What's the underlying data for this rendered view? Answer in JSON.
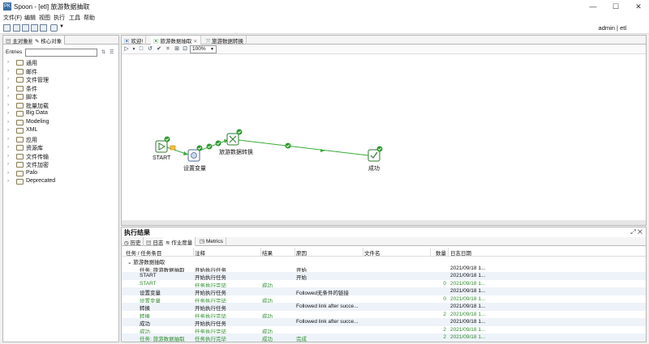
{
  "window": {
    "title": "Spoon - [etl] 旅游数据抽取",
    "app_icon": "PK",
    "minimize": "—",
    "maximize": "☐",
    "close": "✕"
  },
  "menu": [
    "文件(F)",
    "编辑",
    "视图",
    "执行",
    "工具",
    "帮助"
  ],
  "user": "admin  |  etl",
  "left_panel": {
    "tabs": [
      "主对象树",
      "核心对象"
    ],
    "entries_label": "Entries",
    "entries_value": "",
    "tree": [
      "通用",
      "邮件",
      "文件管理",
      "条件",
      "脚本",
      "批量加载",
      "Big Data",
      "Modeling",
      "XML",
      "应用",
      "资源库",
      "文件传输",
      "文件加密",
      "Palo",
      "Deprecated"
    ]
  },
  "editor": {
    "tabs": [
      "欢迎!",
      "旅游数据抽取",
      "旅游数据转换"
    ],
    "zoom": "100%",
    "nodes": {
      "start": "START",
      "set_var": "设置变量",
      "transform": "旅游数据转换",
      "success": "成功"
    }
  },
  "results": {
    "title": "执行结果",
    "tabs": [
      "历史",
      "日志",
      "作业度量",
      "Metrics"
    ],
    "columns": [
      "任务 / 任务条目",
      "注释",
      "结果",
      "原因",
      "文件名",
      "数量",
      "日志日期"
    ],
    "group": "旅游数据抽取",
    "rows": [
      {
        "entry": "任务: 旅游数据抽取",
        "comment": "开始执行任务",
        "result": "",
        "reason": "开始",
        "file": "",
        "count": "",
        "date": "2021/09/18 1...",
        "green": false
      },
      {
        "entry": "START",
        "comment": "开始执行任务",
        "result": "",
        "reason": "开始",
        "file": "",
        "count": "",
        "date": "2021/09/18 1...",
        "green": false
      },
      {
        "entry": "START",
        "comment": "任务执行完毕",
        "result": "成功",
        "reason": "",
        "file": "",
        "count": "0",
        "date": "2021/09/18 1...",
        "green": true
      },
      {
        "entry": "设置变量",
        "comment": "开始执行任务",
        "result": "",
        "reason": "Followed无条件的链接",
        "file": "",
        "count": "",
        "date": "2021/09/18 1...",
        "green": false
      },
      {
        "entry": "设置变量",
        "comment": "任务执行完毕",
        "result": "成功",
        "reason": "",
        "file": "",
        "count": "0",
        "date": "2021/09/18 1...",
        "green": true
      },
      {
        "entry": "转换",
        "comment": "开始执行任务",
        "result": "",
        "reason": "Followed link after succe...",
        "file": "",
        "count": "",
        "date": "2021/09/18 1...",
        "green": false
      },
      {
        "entry": "转换",
        "comment": "任务执行完毕",
        "result": "成功",
        "reason": "",
        "file": "",
        "count": "2",
        "date": "2021/09/18 1...",
        "green": true
      },
      {
        "entry": "成功",
        "comment": "开始执行任务",
        "result": "",
        "reason": "Followed link after succe...",
        "file": "",
        "count": "",
        "date": "2021/09/18 1...",
        "green": false
      },
      {
        "entry": "成功",
        "comment": "任务执行完毕",
        "result": "成功",
        "reason": "",
        "file": "",
        "count": "2",
        "date": "2021/09/18 1...",
        "green": true
      },
      {
        "entry": "任务: 旅游数据抽取",
        "comment": "任务执行完毕",
        "result": "成功",
        "reason": "完成",
        "file": "",
        "count": "2",
        "date": "2021/09/18 1...",
        "green": true
      }
    ]
  },
  "colors": {
    "accent": "#2e9a2e",
    "hop": "#3aaa3a",
    "start_node": "#2c7a2c",
    "selection": "#3a6ea5"
  }
}
